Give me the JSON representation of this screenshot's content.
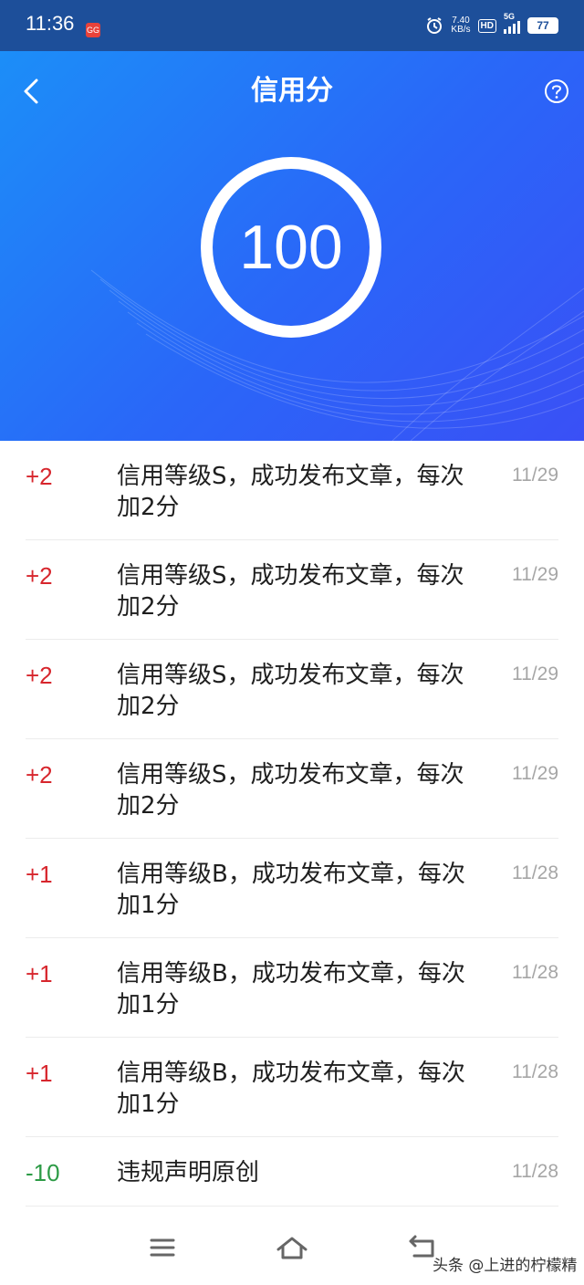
{
  "status_bar": {
    "time": "11:36",
    "notification_badge": "GG",
    "net_speed_value": "7.40",
    "net_speed_unit": "KB/s",
    "hd_label": "HD",
    "network_label": "5G",
    "battery": "77",
    "icons": [
      "alarm-icon",
      "signal-icon",
      "battery-icon"
    ]
  },
  "header": {
    "title": "信用分",
    "back_icon": "chevron-left-icon",
    "help_icon": "question-circle-icon",
    "score": "100",
    "gradient_colors": [
      "#1c8ef8",
      "#3a50f6"
    ]
  },
  "records": [
    {
      "delta": "+2",
      "description": "信用等级S，成功发布文章，每次加2分",
      "date": "11/29",
      "type": "positive"
    },
    {
      "delta": "+2",
      "description": "信用等级S，成功发布文章，每次加2分",
      "date": "11/29",
      "type": "positive"
    },
    {
      "delta": "+2",
      "description": "信用等级S，成功发布文章，每次加2分",
      "date": "11/29",
      "type": "positive"
    },
    {
      "delta": "+2",
      "description": "信用等级S，成功发布文章，每次加2分",
      "date": "11/29",
      "type": "positive"
    },
    {
      "delta": "+1",
      "description": "信用等级B，成功发布文章，每次加1分",
      "date": "11/28",
      "type": "positive"
    },
    {
      "delta": "+1",
      "description": "信用等级B，成功发布文章，每次加1分",
      "date": "11/28",
      "type": "positive"
    },
    {
      "delta": "+1",
      "description": "信用等级B，成功发布文章，每次加1分",
      "date": "11/28",
      "type": "positive"
    },
    {
      "delta": "-10",
      "description": "违规声明原创",
      "date": "11/28",
      "type": "negative"
    }
  ],
  "colors": {
    "positive": "#d7262d",
    "negative": "#2d9b46",
    "date": "#a6a6a6"
  },
  "nav_bar": {
    "icons": [
      "menu-icon",
      "home-icon",
      "back-icon"
    ]
  },
  "watermark": "头条 @上进的柠檬精"
}
